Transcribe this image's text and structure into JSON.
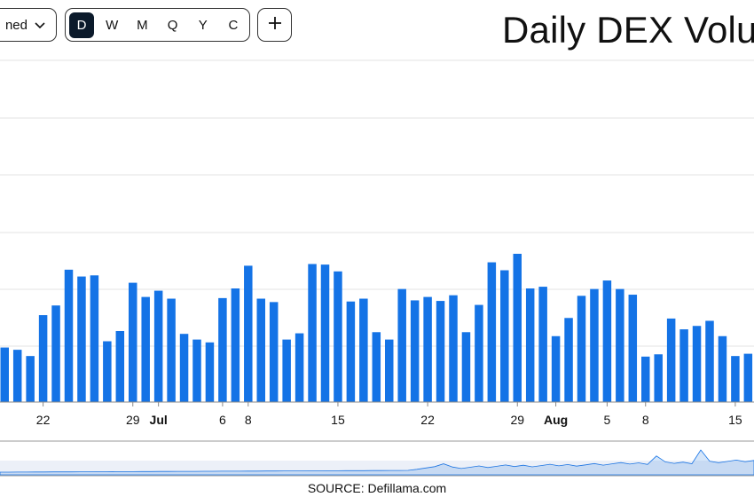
{
  "toolbar": {
    "dropdown_label": "ned",
    "ranges": [
      "D",
      "W",
      "M",
      "Q",
      "Y",
      "C"
    ],
    "active_range": "D",
    "add_label": "+"
  },
  "chart_data": {
    "type": "bar",
    "title": "Daily DEX Volu",
    "xlabel": "",
    "ylabel": "",
    "grid": true,
    "bar_color": "#1473e6",
    "x_tick_labels": [
      {
        "label": "22",
        "bold": false
      },
      {
        "label": "29",
        "bold": false
      },
      {
        "label": "Jul",
        "bold": true
      },
      {
        "label": "6",
        "bold": false
      },
      {
        "label": "8",
        "bold": false
      },
      {
        "label": "15",
        "bold": false
      },
      {
        "label": "22",
        "bold": false
      },
      {
        "label": "29",
        "bold": false
      },
      {
        "label": "Aug",
        "bold": true
      },
      {
        "label": "5",
        "bold": false
      },
      {
        "label": "8",
        "bold": false
      },
      {
        "label": "15",
        "bold": false
      }
    ],
    "values": [
      0.96,
      0.92,
      0.81,
      1.53,
      1.7,
      2.33,
      2.21,
      2.23,
      1.07,
      1.25,
      2.1,
      1.85,
      1.96,
      1.82,
      1.2,
      1.1,
      1.05,
      1.83,
      2.0,
      2.4,
      1.82,
      1.76,
      1.1,
      1.21,
      2.43,
      2.42,
      2.3,
      1.77,
      1.82,
      1.23,
      1.1,
      1.99,
      1.79,
      1.85,
      1.78,
      1.88,
      1.23,
      1.71,
      2.46,
      2.32,
      2.61,
      2.0,
      2.03,
      1.16,
      1.48,
      1.87,
      1.99,
      2.14,
      1.99,
      1.89,
      0.8,
      0.84,
      1.47,
      1.28,
      1.34,
      1.43,
      1.16,
      0.81,
      0.85
    ]
  },
  "navigator": {
    "color": "#1473e6"
  },
  "source": "SOURCE: Defillama.com"
}
